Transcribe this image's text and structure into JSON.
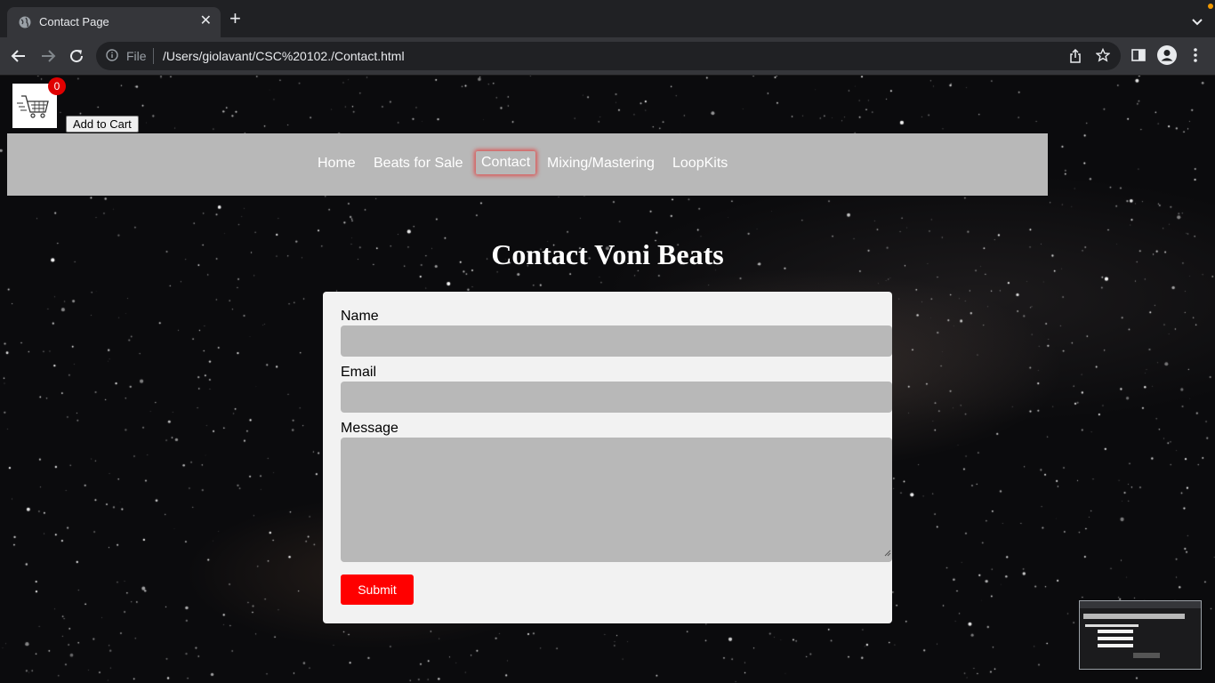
{
  "browser": {
    "tab_title": "Contact Page",
    "close_glyph": "✕",
    "new_tab_glyph": "+",
    "url_scheme": "File",
    "url": "/Users/giolavant/CSC%20102./Contact.html"
  },
  "icons": [
    "globe-icon",
    "close-icon",
    "plus-icon",
    "chevron-down-icon",
    "back-arrow-icon",
    "forward-arrow-icon",
    "reload-icon",
    "info-icon",
    "share-icon",
    "star-icon",
    "side-panel-icon",
    "profile-icon",
    "kebab-menu-icon",
    "cart-icon"
  ],
  "colors": {
    "accent_red": "#ff0000",
    "nav_background": "#b8b8b8",
    "card_background": "#f2f2f2",
    "active_glow": "#e14646"
  },
  "cart": {
    "count": "0",
    "add_label": "Add to Cart"
  },
  "nav": {
    "items": [
      {
        "label": "Home"
      },
      {
        "label": "Beats for Sale"
      },
      {
        "label": "Contact"
      },
      {
        "label": "Mixing/Mastering"
      },
      {
        "label": "LoopKits"
      }
    ],
    "active": "Contact"
  },
  "page": {
    "title": "Contact Voni Beats"
  },
  "form": {
    "name_label": "Name",
    "name_value": "",
    "email_label": "Email",
    "email_value": "",
    "message_label": "Message",
    "message_value": "",
    "submit_label": "Submit"
  }
}
